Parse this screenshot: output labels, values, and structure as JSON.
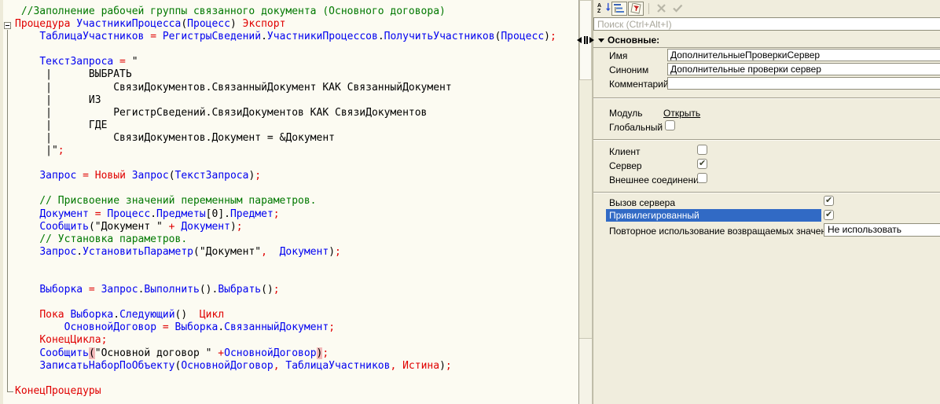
{
  "app": "1C Designer — module editor with properties palette",
  "editor": {
    "colors": {
      "keyword": "#E00000",
      "identifier": "#0000F0",
      "comment": "#007800",
      "string": "#000000",
      "bracket_highlight_bg": "#F2B9B9",
      "background": "#FCFBF2"
    },
    "lines": [
      {
        "tokens": [
          [
            "c",
            " //Заполнение рабочей группы связанного документа (Основного договора)"
          ]
        ]
      },
      {
        "tokens": [
          [
            "k",
            "Процедура "
          ],
          [
            "i",
            "УчастникиПроцесса"
          ],
          [
            "p",
            "("
          ],
          [
            "i",
            "Процесс"
          ],
          [
            "p",
            ")"
          ],
          [
            "k",
            " Экспорт"
          ]
        ]
      },
      {
        "tokens": [
          [
            "p",
            "    "
          ],
          [
            "i",
            "ТаблицаУчастников"
          ],
          [
            "k",
            " = "
          ],
          [
            "i",
            "РегистрыСведений"
          ],
          [
            "p",
            "."
          ],
          [
            "i",
            "УчастникиПроцессов"
          ],
          [
            "p",
            "."
          ],
          [
            "i",
            "ПолучитьУчастников"
          ],
          [
            "p",
            "("
          ],
          [
            "i",
            "Процесс"
          ],
          [
            "p",
            ")"
          ],
          [
            "k",
            ";"
          ]
        ]
      },
      {
        "tokens": []
      },
      {
        "tokens": [
          [
            "p",
            "    "
          ],
          [
            "i",
            "ТекстЗапроса"
          ],
          [
            "k",
            " = "
          ],
          [
            "s",
            "\""
          ]
        ]
      },
      {
        "tokens": [
          [
            "s",
            "     |      ВЫБРАТЬ"
          ]
        ]
      },
      {
        "tokens": [
          [
            "s",
            "     |          СвязиДокументов.СвязанныйДокумент КАК СвязанныйДокумент"
          ]
        ]
      },
      {
        "tokens": [
          [
            "s",
            "     |      ИЗ"
          ]
        ]
      },
      {
        "tokens": [
          [
            "s",
            "     |          РегистрСведений.СвязиДокументов КАК СвязиДокументов"
          ]
        ]
      },
      {
        "tokens": [
          [
            "s",
            "     |      ГДЕ"
          ]
        ]
      },
      {
        "tokens": [
          [
            "s",
            "     |          СвязиДокументов.Документ = &Документ"
          ]
        ]
      },
      {
        "tokens": [
          [
            "s",
            "     |\""
          ],
          [
            "k",
            ";"
          ]
        ]
      },
      {
        "tokens": []
      },
      {
        "tokens": [
          [
            "p",
            "    "
          ],
          [
            "i",
            "Запрос"
          ],
          [
            "k",
            " = Новый "
          ],
          [
            "i",
            "Запрос"
          ],
          [
            "p",
            "("
          ],
          [
            "i",
            "ТекстЗапроса"
          ],
          [
            "p",
            ")"
          ],
          [
            "k",
            ";"
          ]
        ]
      },
      {
        "tokens": []
      },
      {
        "tokens": [
          [
            "c",
            "    // Присвоение значений переменным параметров."
          ]
        ]
      },
      {
        "tokens": [
          [
            "p",
            "    "
          ],
          [
            "i",
            "Документ"
          ],
          [
            "k",
            " = "
          ],
          [
            "i",
            "Процесс"
          ],
          [
            "p",
            "."
          ],
          [
            "i",
            "Предметы"
          ],
          [
            "p",
            "["
          ],
          [
            "s",
            "0"
          ],
          [
            "p",
            "]."
          ],
          [
            "i",
            "Предмет"
          ],
          [
            "k",
            ";"
          ]
        ]
      },
      {
        "tokens": [
          [
            "p",
            "    "
          ],
          [
            "i",
            "Сообщить"
          ],
          [
            "p",
            "("
          ],
          [
            "s",
            "\"Документ \""
          ],
          [
            "k",
            " + "
          ],
          [
            "i",
            "Документ"
          ],
          [
            "p",
            ")"
          ],
          [
            "k",
            ";"
          ]
        ]
      },
      {
        "tokens": [
          [
            "c",
            "    // Установка параметров."
          ]
        ]
      },
      {
        "tokens": [
          [
            "p",
            "    "
          ],
          [
            "i",
            "Запрос"
          ],
          [
            "p",
            "."
          ],
          [
            "i",
            "УстановитьПараметр"
          ],
          [
            "p",
            "("
          ],
          [
            "s",
            "\"Документ\""
          ],
          [
            "k",
            ","
          ],
          [
            "p",
            "  "
          ],
          [
            "i",
            "Документ"
          ],
          [
            "p",
            ")"
          ],
          [
            "k",
            ";"
          ]
        ]
      },
      {
        "tokens": []
      },
      {
        "tokens": []
      },
      {
        "tokens": [
          [
            "p",
            "    "
          ],
          [
            "i",
            "Выборка"
          ],
          [
            "k",
            " = "
          ],
          [
            "i",
            "Запрос"
          ],
          [
            "p",
            "."
          ],
          [
            "i",
            "Выполнить"
          ],
          [
            "p",
            "()."
          ],
          [
            "i",
            "Выбрать"
          ],
          [
            "p",
            "()"
          ],
          [
            "k",
            ";"
          ]
        ]
      },
      {
        "tokens": []
      },
      {
        "tokens": [
          [
            "p",
            "    "
          ],
          [
            "k",
            "Пока "
          ],
          [
            "i",
            "Выборка"
          ],
          [
            "p",
            "."
          ],
          [
            "i",
            "Следующий"
          ],
          [
            "p",
            "()"
          ],
          [
            "k",
            "  Цикл"
          ]
        ]
      },
      {
        "tokens": [
          [
            "p",
            "        "
          ],
          [
            "i",
            "ОсновнойДоговор"
          ],
          [
            "k",
            " = "
          ],
          [
            "i",
            "Выборка"
          ],
          [
            "p",
            "."
          ],
          [
            "i",
            "СвязанныйДокумент"
          ],
          [
            "k",
            ";"
          ]
        ]
      },
      {
        "tokens": [
          [
            "p",
            "    "
          ],
          [
            "k",
            "КонецЦикла;"
          ]
        ]
      },
      {
        "tokens": [
          [
            "p",
            "    "
          ],
          [
            "i",
            "Сообщить"
          ],
          [
            "hb",
            "("
          ],
          [
            "s",
            "\"Основной договор \""
          ],
          [
            "k",
            " +"
          ],
          [
            "i",
            "ОсновнойДоговор"
          ],
          [
            "hb",
            ")"
          ],
          [
            "k",
            ";"
          ]
        ]
      },
      {
        "tokens": [
          [
            "p",
            "    "
          ],
          [
            "i",
            "ЗаписатьНаборПоОбъекту"
          ],
          [
            "p",
            "("
          ],
          [
            "i",
            "ОсновнойДоговор"
          ],
          [
            "k",
            ","
          ],
          [
            "p",
            " "
          ],
          [
            "i",
            "ТаблицаУчастников"
          ],
          [
            "k",
            ","
          ],
          [
            "p",
            " "
          ],
          [
            "k",
            "Истина"
          ],
          [
            "p",
            ")"
          ],
          [
            "k",
            ";"
          ]
        ]
      },
      {
        "tokens": []
      },
      {
        "tokens": [
          [
            "k",
            "КонецПроцедуры"
          ]
        ]
      }
    ]
  },
  "panel": {
    "search_placeholder": "Поиск (Ctrl+Alt+I)",
    "section_header": "Основные:",
    "fields": [
      {
        "label": "Имя",
        "value": "ДополнительныеПроверкиСервер"
      },
      {
        "label": "Синоним",
        "value": "Дополнительные проверки сервер"
      },
      {
        "label": "Комментарий",
        "value": ""
      }
    ],
    "module": {
      "label": "Модуль",
      "link": "Открыть"
    },
    "global": {
      "label": "Глобальный",
      "checked": false
    },
    "client": {
      "label": "Клиент",
      "checked": false
    },
    "server": {
      "label": "Сервер",
      "checked": true
    },
    "external_connection": {
      "label": "Внешнее соединение",
      "checked": false
    },
    "server_call": {
      "label": "Вызов сервера",
      "checked": true
    },
    "privileged": {
      "label": "Привилегированный",
      "checked": true,
      "selected": true
    },
    "reuse": {
      "label": "Повторное использование возвращаемых значений",
      "value": "Не использовать"
    },
    "icons": {
      "sort": "sort-az-icon",
      "categorized": "categorized-view-icon",
      "important": "important-properties-icon",
      "cancel": "cancel-x-icon",
      "apply": "apply-check-icon",
      "splitter": "splitter-grip-icon"
    },
    "colors": {
      "selection": "#316AC5",
      "panel_bg": "#F0EDDD"
    }
  }
}
